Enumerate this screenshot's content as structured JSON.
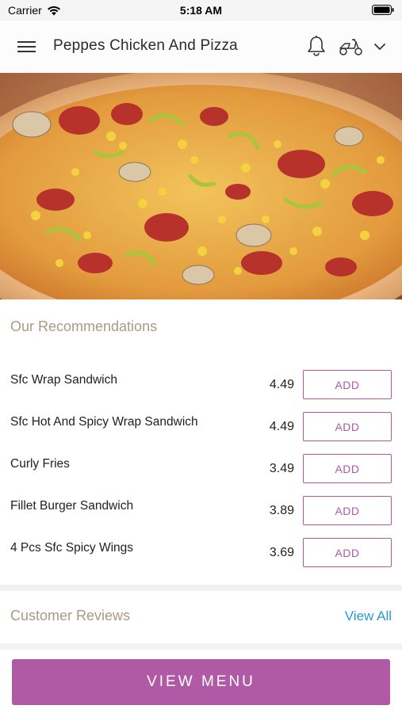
{
  "status_bar": {
    "carrier": "Carrier",
    "time": "5:18 AM"
  },
  "header": {
    "title": "Peppes Chicken And Pizza",
    "icons": [
      "menu-icon",
      "bell-icon",
      "scooter-icon",
      "chevron-down-icon"
    ]
  },
  "recommendations": {
    "title": "Our Recommendations",
    "items": [
      {
        "name": "Sfc Wrap Sandwich",
        "price": "4.49",
        "action": "ADD"
      },
      {
        "name": "Sfc Hot And Spicy Wrap Sandwich",
        "price": "4.49",
        "action": "ADD"
      },
      {
        "name": "Curly Fries",
        "price": "3.49",
        "action": "ADD"
      },
      {
        "name": "Fillet Burger Sandwich",
        "price": "3.89",
        "action": "ADD"
      },
      {
        "name": "4 Pcs Sfc Spicy Wings",
        "price": "3.69",
        "action": "ADD"
      }
    ]
  },
  "reviews": {
    "title": "Customer Reviews",
    "view_all": "View All"
  },
  "footer": {
    "button_label": "VIEW MENU"
  },
  "colors": {
    "accent": "#b05aa6",
    "section_title": "#a99a83",
    "link": "#2b9ad0"
  }
}
